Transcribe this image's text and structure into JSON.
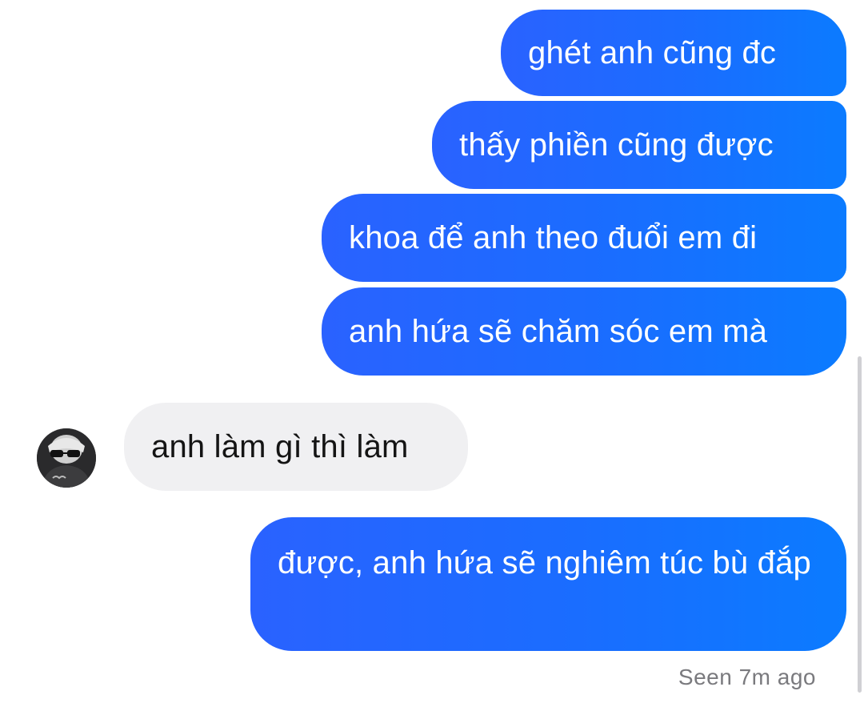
{
  "messages": [
    {
      "direction": "outgoing",
      "text": "ghét anh cũng đc"
    },
    {
      "direction": "outgoing",
      "text": "thấy phiền cũng được"
    },
    {
      "direction": "outgoing",
      "text": "khoa để anh theo đuổi em đi"
    },
    {
      "direction": "outgoing",
      "text": "anh hứa sẽ chăm sóc em mà"
    },
    {
      "direction": "incoming",
      "text": "anh làm gì thì làm"
    },
    {
      "direction": "outgoing",
      "text": "được, anh hứa sẽ nghiêm túc bù đắp"
    }
  ],
  "status": {
    "seen": "Seen 7m ago"
  },
  "colors": {
    "outgoing_bubble": "#1a6dff",
    "incoming_bubble": "#f0f0f2",
    "outgoing_text": "#ffffff",
    "incoming_text": "#141414",
    "status_text": "#7a7a7e"
  },
  "icons": {
    "avatar": "contact-avatar-photo"
  }
}
